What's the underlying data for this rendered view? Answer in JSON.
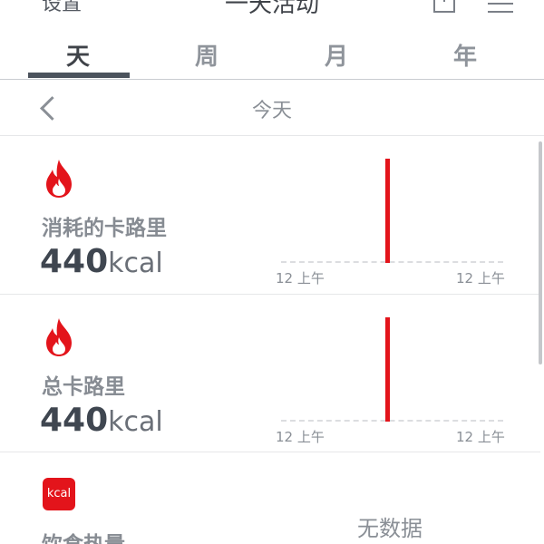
{
  "topbar": {
    "left_action": "设置",
    "title": "一天活动",
    "share_icon": "share-icon",
    "menu_icon": "list-menu-icon"
  },
  "tabs": [
    {
      "label": "天",
      "active": true
    },
    {
      "label": "周",
      "active": false
    },
    {
      "label": "月",
      "active": false
    },
    {
      "label": "年",
      "active": false
    }
  ],
  "date_row": {
    "back_icon": "chevron-left-icon",
    "label": "今天"
  },
  "cards": [
    {
      "icon": "flame-icon",
      "label": "消耗的卡路里",
      "value": "440",
      "unit": "kcal",
      "chart": {
        "type": "bar",
        "x_ticks": [
          "12 上午",
          "12 上午"
        ],
        "bar_color": "#e3141b"
      }
    },
    {
      "icon": "flame-icon",
      "label": "总卡路里",
      "value": "440",
      "unit": "kcal",
      "chart": {
        "type": "bar",
        "x_ticks": [
          "12 上午",
          "12 上午"
        ],
        "bar_color": "#e3141b"
      }
    },
    {
      "icon": "kcal-icon",
      "icon_text": "kcal",
      "label": "饮食热量",
      "no_data": "无数据"
    }
  ],
  "colors": {
    "accent": "#e3141b",
    "text_dark": "#3f4650",
    "text_muted": "#8a8f96"
  }
}
